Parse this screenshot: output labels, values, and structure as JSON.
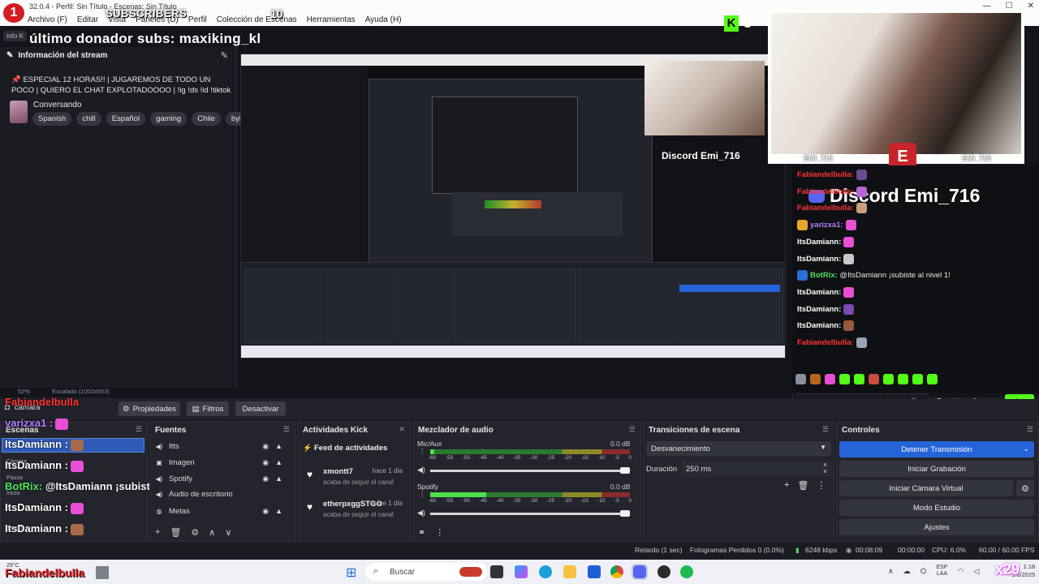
{
  "window": {
    "title": "32.0.4 - Perfil: Sin Título - Escenas: Sin Título",
    "menu": [
      "Archivo (F)",
      "Editar",
      "Vista",
      "Paneles (D)",
      "Perfil",
      "Colección de Escenas",
      "Herramientas",
      "Ayuda (H)"
    ],
    "controls": [
      "—",
      "☐",
      "✕"
    ]
  },
  "overlay": {
    "subs_badge": "1",
    "subs_label": "SUBSCRIBERS",
    "subs_count": "10",
    "donor_banner": "último donador subs: maxiking_kl",
    "kick_count": "5",
    "cam_name_left": "EMI_716",
    "cam_name_right": "EMI_716",
    "cam_logo": "E",
    "discord_banner": "Discord Emi_716",
    "chat": [
      {
        "user": "Fabiandelbulla:",
        "color": "red",
        "text": "",
        "emote": "#6b4a8f"
      },
      {
        "user": "Fabiandelbulla:",
        "color": "red",
        "text": "",
        "emote": "#b565d8"
      },
      {
        "user": "Fabiandelbulla:",
        "color": "red",
        "text": "",
        "emote": "#c8a07a"
      },
      {
        "user": "yarizxa1:",
        "color": "purple",
        "text": "",
        "emote": "#e94ed6"
      },
      {
        "user": "ItsDamiann:",
        "color": "white",
        "text": "",
        "emote": "#e94ed6"
      },
      {
        "user": "ItsDamiann:",
        "color": "white",
        "text": "",
        "emote": "#c9c9c9"
      },
      {
        "user": "BotRix:",
        "color": "green",
        "text": " @ItsDamiann ¡subiste al nivel 1!",
        "emote": ""
      },
      {
        "user": "ItsDamiann:",
        "color": "white",
        "text": "",
        "emote": "#e94ed6"
      },
      {
        "user": "ItsDamiann:",
        "color": "white",
        "text": "",
        "emote": "#7a4ab0"
      },
      {
        "user": "ItsDamiann:",
        "color": "white",
        "text": "",
        "emote": "#9a5a3a"
      },
      {
        "user": "Fabiandelbulla:",
        "color": "red",
        "text": "",
        "emote": "#9aa3b5"
      }
    ],
    "chat_input_placeholder": "Enviar un mensaje",
    "chat_button": "Chat"
  },
  "stream_info": {
    "header_chip": "Info K",
    "title": "Información del stream",
    "stream_title": "📌 ESPECIAL 12 HORAS!! | JUGAREMOS DE TODO UN POCO | QUIERO EL CHAT EXPLOTADOOOO | !ig !ds !id !tiktok",
    "category": "Conversando",
    "tags": [
      "Spanish",
      "chill",
      "Español",
      "gaming",
      "Chile",
      "byl"
    ]
  },
  "preview": {
    "zoom": "52%",
    "scale": "Escalado (1002x563)"
  },
  "toolbar": {
    "source_name": "camara",
    "properties": "Propiedades",
    "filters": "Filtros",
    "deactivate": "Desactivar"
  },
  "scenes": {
    "title": "Escenas",
    "lines": [
      {
        "user": "Fabiandelbulla",
        "color": "red",
        "text": ""
      },
      {
        "user": "yarizxa1 :",
        "color": "purple",
        "text": ""
      },
      {
        "user": "ItsDamiann :",
        "color": "white",
        "text": ""
      },
      {
        "user": "ItsDamiann :",
        "color": "white",
        "text": ""
      },
      {
        "user": "BotRix:",
        "color": "green",
        "text": " @ItsDamiann ¡subiste al nivel 1!"
      },
      {
        "user": "ItsDamiann :",
        "color": "white",
        "text": ""
      },
      {
        "user": "ItsDamiann :",
        "color": "white",
        "text": ""
      },
      {
        "user": "ItsDamiann :",
        "color": "white",
        "text": ""
      }
    ],
    "small_labels": [
      "Cámara",
      "Pausa",
      "Inicio",
      "Juego"
    ]
  },
  "sources": {
    "title": "Fuentes",
    "items": [
      {
        "name": "Itts",
        "icon": "audio-icon"
      },
      {
        "name": "Imagen",
        "icon": "image-icon"
      },
      {
        "name": "Spotify",
        "icon": "audio-icon"
      },
      {
        "name": "Audio de escritorio",
        "icon": "audio-icon"
      },
      {
        "name": "Metas",
        "icon": "browser-icon"
      }
    ]
  },
  "activity": {
    "title": "Actividades Kick",
    "feed_title": "Feed de actividades",
    "items": [
      {
        "user": "xmontt7",
        "time": "hace 1 día",
        "desc": "acaba de seguir el canal"
      },
      {
        "user": "etherpxggSTGO",
        "time": "hace 1 día",
        "desc": "acaba de seguir el canal"
      }
    ]
  },
  "mixer": {
    "title": "Mezclador de audio",
    "channels": [
      {
        "name": "Mic/Aux",
        "db": "0.0 dB",
        "level": 0.02
      },
      {
        "name": "Spotify",
        "db": "0.0 dB",
        "level": 0.28
      }
    ],
    "scale": [
      "-60",
      "-55",
      "-50",
      "-45",
      "-40",
      "-35",
      "-30",
      "-25",
      "-20",
      "-15",
      "-10",
      "-5",
      "0"
    ]
  },
  "transitions": {
    "title": "Transiciones de escena",
    "selected": "Desvanecimiento",
    "duration_label": "Duración",
    "duration_value": "250 ms"
  },
  "controls": {
    "title": "Controles",
    "buttons": [
      "Detener Transmisión",
      "Iniciar Grabación",
      "Iniciar Cámara Virtual",
      "Modo Estudio",
      "Ajustes"
    ]
  },
  "status": {
    "delay": "Retardo (1 sec)",
    "dropped": "Fotogramas Perdidos 0 (0.0%)",
    "bitrate": "6248 kbps",
    "live_time": "00:08:09",
    "rec_time": "00:00:00",
    "cpu": "CPU: 6.0%",
    "fps": "60.00 / 60.00 FPS"
  },
  "taskbar": {
    "weather": "29°C",
    "brand": "Fabiandelbulla",
    "search": "Buscar",
    "lang_top": "ESP",
    "lang_bottom": "LAA",
    "time": "1:18",
    "date": "1/6/2025",
    "overlay_count": "x29"
  },
  "colors": {
    "accent_blue": "#2563d9",
    "kick_green": "#53fc18",
    "brand_red": "#d31d22",
    "discord": "#5865f2"
  }
}
